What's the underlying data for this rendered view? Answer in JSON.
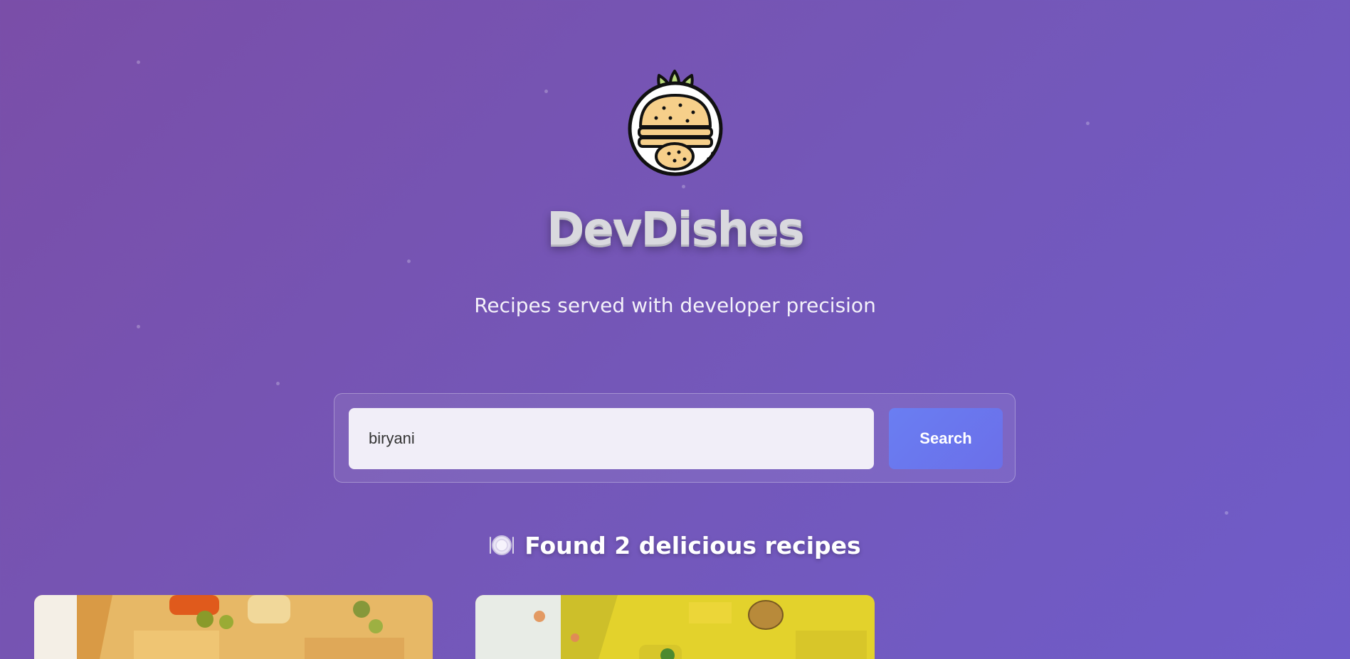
{
  "app": {
    "title": "DevDishes",
    "tagline": "Recipes served with developer precision",
    "logo_icon": "burger-logo-icon"
  },
  "search": {
    "value": "biryani",
    "button_label": "Search"
  },
  "results": {
    "icon": "plate-icon",
    "heading": "Found 2 delicious recipes",
    "cards": [
      {
        "image": "vegetable-biryani-image"
      },
      {
        "image": "yellow-rice-biryani-image"
      }
    ]
  },
  "colors": {
    "background_start": "#7a4ea8",
    "background_end": "#6f5cc9",
    "button": "#6a7ef2",
    "input_bg": "#f1eef8"
  }
}
